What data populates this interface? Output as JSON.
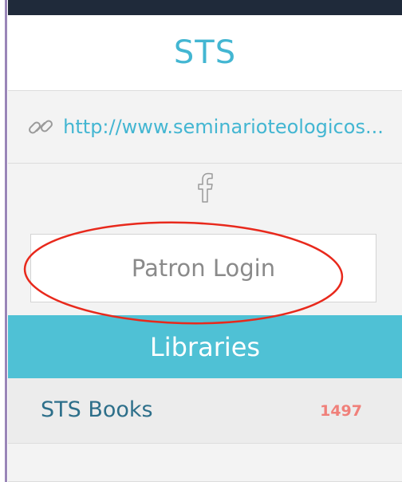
{
  "header": {
    "title": "STS"
  },
  "website": {
    "url_text": "http://www.seminarioteologicos..."
  },
  "social": {
    "icon": "facebook-icon"
  },
  "login": {
    "label": "Patron Login"
  },
  "libraries": {
    "heading": "Libraries",
    "items": [
      {
        "name": "STS Books",
        "count": "1497"
      }
    ]
  },
  "colors": {
    "accent": "#43b6d2",
    "section_header": "#4fc1d5",
    "count": "#f0807a",
    "annotation": "#e8291c",
    "top_bar": "#1f2a3a"
  }
}
